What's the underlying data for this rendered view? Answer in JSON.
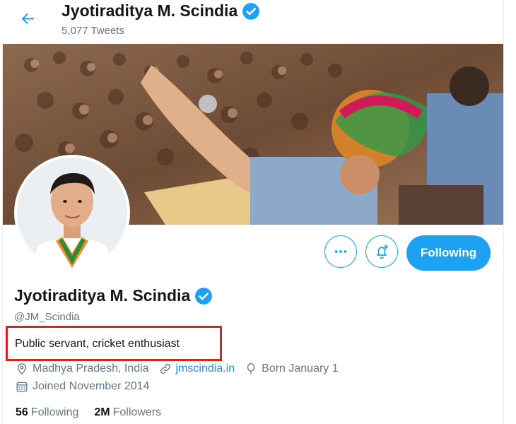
{
  "header": {
    "display_name": "Jyotiraditya M. Scindia",
    "tweet_count": "5,077 Tweets"
  },
  "profile": {
    "display_name": "Jyotiraditya M. Scindia",
    "handle": "@JM_Scindia",
    "bio": "Public servant, cricket enthusiast",
    "location": "Madhya Pradesh, India",
    "website": "jmscindia.in",
    "born": "Born January 1",
    "joined": "Joined November 2014"
  },
  "actions": {
    "following_label": "Following"
  },
  "stats": {
    "following_count": "56",
    "following_label": "Following",
    "followers_count": "2M",
    "followers_label": "Followers"
  },
  "colors": {
    "accent": "#1da1f2",
    "link": "#1b95e0",
    "muted": "#657786",
    "highlight_box": "#e0211b"
  },
  "icons": {
    "back": "back-arrow-icon",
    "verified": "verified-badge-icon",
    "more": "more-icon",
    "notify": "notification-bell-icon",
    "location": "location-pin-icon",
    "link": "link-icon",
    "birthday": "balloon-icon",
    "calendar": "calendar-icon"
  }
}
